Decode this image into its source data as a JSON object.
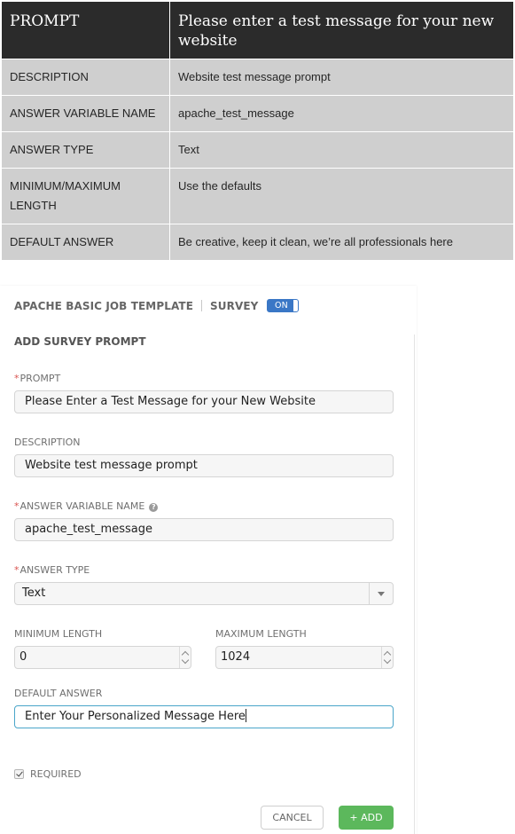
{
  "reference_table": {
    "header": {
      "key": "PROMPT",
      "value": "Please enter a test message for your new website"
    },
    "rows": [
      {
        "key": "DESCRIPTION",
        "value": "Website test message prompt"
      },
      {
        "key": "ANSWER VARIABLE NAME",
        "value": "apache_test_message"
      },
      {
        "key": "ANSWER TYPE",
        "value": "Text"
      },
      {
        "key": "MINIMUM/MAXIMUM LENGTH",
        "value": "Use the defaults"
      },
      {
        "key": "DEFAULT ANSWER",
        "value": "Be creative, keep it clean, we’re all professionals here"
      }
    ]
  },
  "panel": {
    "breadcrumb_template": "APACHE BASIC JOB TEMPLATE",
    "breadcrumb_survey": "SURVEY",
    "survey_toggle": "ON",
    "section_title": "ADD SURVEY PROMPT",
    "required_marker": "*",
    "prompt": {
      "label": "PROMPT",
      "value": "Please Enter a Test Message for your New Website"
    },
    "description": {
      "label": "DESCRIPTION",
      "value": "Website test message prompt"
    },
    "answer_variable_name": {
      "label": "ANSWER VARIABLE NAME",
      "help": "?",
      "value": "apache_test_message"
    },
    "answer_type": {
      "label": "ANSWER TYPE",
      "value": "Text"
    },
    "minimum_length": {
      "label": "MINIMUM LENGTH",
      "value": "0"
    },
    "maximum_length": {
      "label": "MAXIMUM LENGTH",
      "value": "1024"
    },
    "default_answer": {
      "label": "DEFAULT ANSWER",
      "value": "Enter Your Personalized Message Here"
    },
    "required": {
      "label": "REQUIRED",
      "checked": true
    },
    "cancel_label": "CANCEL",
    "add_label": "+ ADD"
  },
  "colors": {
    "header_bg": "#2b2b2b",
    "row_bg": "#cfcfcf",
    "toggle_blue": "#3a77c6",
    "add_green": "#5cb85c",
    "required_red": "#d9534f",
    "focus_border": "#4aa5c9"
  },
  "icons": [
    "help-icon",
    "chevron-down-icon",
    "spinner-up-icon",
    "spinner-down-icon",
    "checkmark-icon"
  ]
}
